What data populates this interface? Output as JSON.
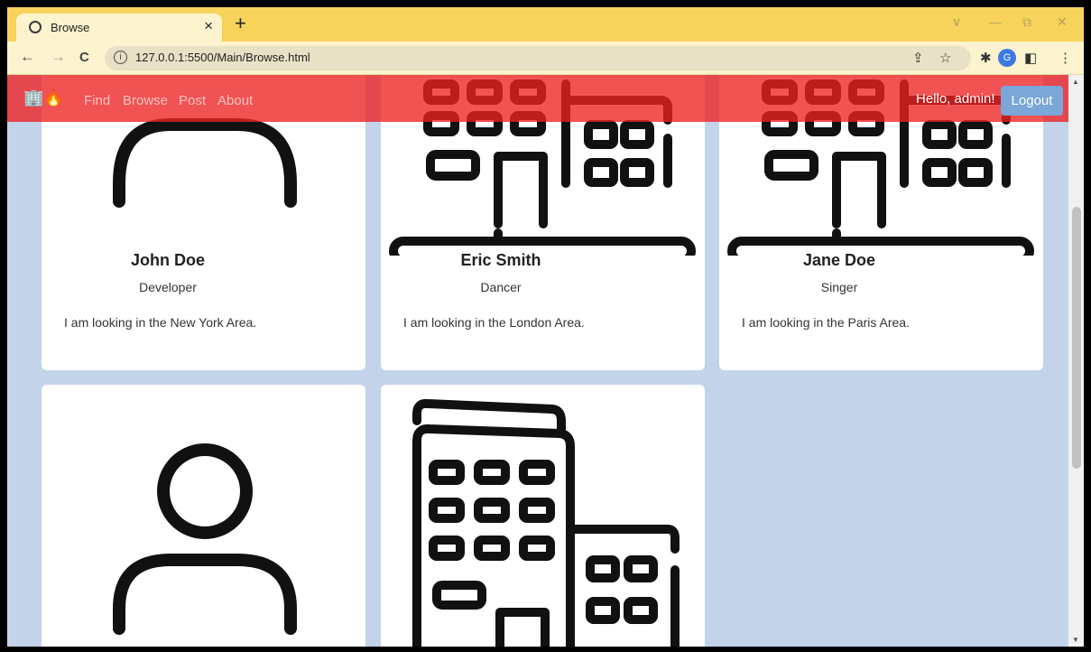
{
  "browser": {
    "tab_title": "Browse",
    "tab_close": "×",
    "new_tab": "+",
    "url": "127.0.0.1:5500/Main/Browse.html",
    "profile_initial": "G",
    "nav": {
      "back": "←",
      "forward": "→",
      "reload": "C"
    },
    "info_glyph": "i",
    "window_controls": {
      "chevron": "∨",
      "minimize": "—",
      "restore": "⧉",
      "close": "✕"
    },
    "toolbar_icons": {
      "share": "⇪",
      "star": "☆",
      "extensions": "✱",
      "sidepanel": "◧",
      "menu": "⋮"
    }
  },
  "navbar": {
    "logo": "🏢🔥",
    "links": [
      "Find",
      "Browse",
      "Post",
      "About"
    ],
    "greeting": "Hello, admin!",
    "logout_label": "Logout",
    "color": "#ed2121"
  },
  "cards": [
    {
      "name": "John Doe",
      "role": "Developer",
      "description": "I am looking in the New York Area.",
      "icon": "user-icon"
    },
    {
      "name": "Eric Smith",
      "role": "Dancer",
      "description": "I am looking in the London Area.",
      "icon": "building-icon"
    },
    {
      "name": "Jane Doe",
      "role": "Singer",
      "description": "I am looking in the Paris Area.",
      "icon": "building-icon"
    },
    {
      "icon": "user-icon"
    },
    {
      "icon": "building-icon"
    }
  ],
  "page_background": "#c3d3ea"
}
